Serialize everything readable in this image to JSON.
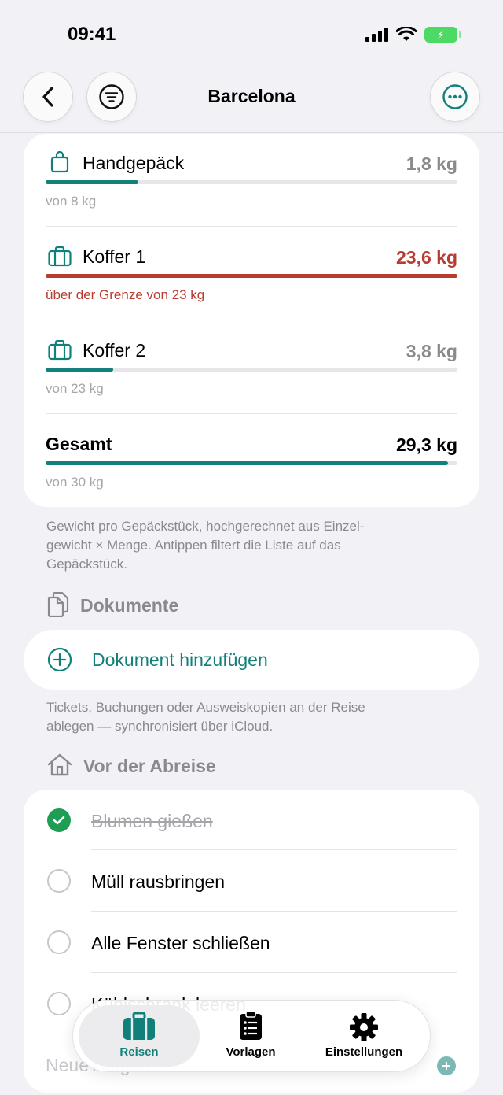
{
  "status": {
    "time": "09:41"
  },
  "nav": {
    "title": "Barcelona"
  },
  "luggage": [
    {
      "name": "Handgepäck",
      "weight": "1,8 kg",
      "sub": "von 8 kg",
      "fraction": 0.225,
      "over": false
    },
    {
      "name": "Koffer 1",
      "weight": "23,6 kg",
      "sub": "über der Grenze von 23 kg",
      "fraction": 1.0,
      "over": true
    },
    {
      "name": "Koffer 2",
      "weight": "3,8 kg",
      "sub": "von 23 kg",
      "fraction": 0.165,
      "over": false
    }
  ],
  "total": {
    "name": "Gesamt",
    "weight": "29,3 kg",
    "sub": "von 30 kg",
    "fraction": 0.977
  },
  "weight_note": "Gewicht pro Gepäckstück, hochgerechnet aus Einzel-gewicht × Menge. Antippen filtert die Liste auf das Gepäckstück.",
  "weight_note_lines": [
    "Gewicht pro Gepäckstück, hochgerechnet aus Einzel-",
    "gewicht × Menge. Antippen filtert die Liste auf das",
    "Gepäckstück."
  ],
  "documents": {
    "title": "Dokumente",
    "add_label": "Dokument hinzufügen",
    "note_lines": [
      "Tickets, Buchungen oder Ausweiskopien an der Reise",
      "ablegen — synchronisiert über iCloud."
    ]
  },
  "departure": {
    "title": "Vor der Abreise",
    "tasks": [
      {
        "label": "Blumen gießen",
        "done": true
      },
      {
        "label": "Müll rausbringen",
        "done": false
      },
      {
        "label": "Alle Fenster schließen",
        "done": false
      },
      {
        "label": "Kühlschrank leeren",
        "done": false
      }
    ],
    "new_task_placeholder": "Neue Aufgabe"
  },
  "tabs": [
    {
      "label": "Reisen",
      "icon": "suitcase-icon",
      "active": true
    },
    {
      "label": "Vorlagen",
      "icon": "clipboard-list-icon",
      "active": false
    },
    {
      "label": "Einstellungen",
      "icon": "gear-icon",
      "active": false
    }
  ],
  "colors": {
    "accent": "#12807a",
    "danger": "#b83b30",
    "check": "#1f9d55",
    "secondary": "#8a8a8e"
  }
}
